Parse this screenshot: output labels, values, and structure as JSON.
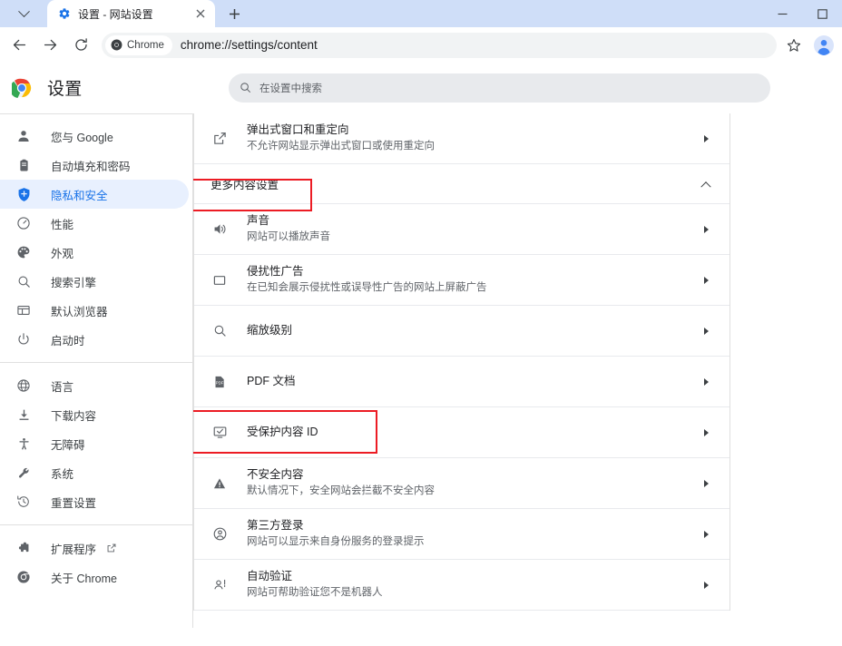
{
  "browser": {
    "tab": {
      "title": "设置 - 网站设置",
      "favicon_icon": "gear-blue-icon",
      "close_icon": "close-icon"
    },
    "tab_search_icon": "chevron-down-icon",
    "new_tab_label": "+",
    "window_controls": [
      {
        "name": "minimize",
        "glyph": "–"
      },
      {
        "name": "maximize",
        "glyph": "□"
      }
    ],
    "toolbar": {
      "back_icon": "back-arrow-icon",
      "forward_icon": "forward-arrow-icon",
      "reload_icon": "reload-icon",
      "chrome_chip_label": "Chrome",
      "url": "chrome://settings/content",
      "bookmark_icon": "star-icon",
      "profile_icon": "avatar-icon"
    }
  },
  "settings": {
    "logo_icon": "chrome-logo-icon",
    "title": "设置",
    "search": {
      "icon": "search-icon",
      "placeholder": "在设置中搜索",
      "value": ""
    }
  },
  "sidebar": {
    "groups": [
      {
        "items": [
          {
            "icon": "person-icon",
            "label": "您与 Google",
            "selected": false
          },
          {
            "icon": "clipboard-icon",
            "label": "自动填充和密码",
            "selected": false
          },
          {
            "icon": "shield-icon",
            "label": "隐私和安全",
            "selected": true
          },
          {
            "icon": "speedometer-icon",
            "label": "性能",
            "selected": false
          },
          {
            "icon": "palette-icon",
            "label": "外观",
            "selected": false
          },
          {
            "icon": "search-icon",
            "label": "搜索引擎",
            "selected": false
          },
          {
            "icon": "browser-window-icon",
            "label": "默认浏览器",
            "selected": false
          },
          {
            "icon": "power-icon",
            "label": "启动时",
            "selected": false
          }
        ]
      },
      {
        "items": [
          {
            "icon": "globe-icon",
            "label": "语言",
            "selected": false
          },
          {
            "icon": "download-icon",
            "label": "下载内容",
            "selected": false
          },
          {
            "icon": "accessibility-icon",
            "label": "无障碍",
            "selected": false
          },
          {
            "icon": "wrench-icon",
            "label": "系统",
            "selected": false
          },
          {
            "icon": "restore-icon",
            "label": "重置设置",
            "selected": false
          }
        ]
      },
      {
        "items": [
          {
            "icon": "puzzle-icon",
            "label": "扩展程序",
            "selected": false,
            "external_link_icon": "open-in-new-icon"
          },
          {
            "icon": "chrome-circle-icon",
            "label": "关于 Chrome",
            "selected": false
          }
        ]
      }
    ]
  },
  "main": {
    "rows": [
      {
        "type": "setting",
        "icon": "popup-redirect-icon",
        "title": "弹出式窗口和重定向",
        "subtitle": "不允许网站显示弹出式窗口或使用重定向",
        "arrow_icon": "chevron-right-icon"
      },
      {
        "type": "section",
        "title": "更多内容设置",
        "arrow_icon": "chevron-up-icon",
        "highlighted": true
      },
      {
        "type": "setting",
        "icon": "sound-icon",
        "title": "声音",
        "subtitle": "网站可以播放声音",
        "arrow_icon": "chevron-right-icon"
      },
      {
        "type": "setting",
        "icon": "intrusive-ads-icon",
        "title": "侵扰性广告",
        "subtitle": "在已知会展示侵扰性或误导性广告的网站上屏蔽广告",
        "arrow_icon": "chevron-right-icon"
      },
      {
        "type": "setting",
        "icon": "zoom-levels-icon",
        "title": "缩放级别",
        "subtitle": "",
        "arrow_icon": "chevron-right-icon"
      },
      {
        "type": "setting",
        "icon": "pdf-icon",
        "title": "PDF 文档",
        "subtitle": "",
        "arrow_icon": "chevron-right-icon"
      },
      {
        "type": "setting",
        "icon": "protected-content-icon",
        "title": "受保护内容 ID",
        "subtitle": "",
        "arrow_icon": "chevron-right-icon",
        "highlighted": true
      },
      {
        "type": "setting",
        "icon": "warning-icon",
        "title": "不安全内容",
        "subtitle": "默认情况下，安全网站会拦截不安全内容",
        "arrow_icon": "chevron-right-icon"
      },
      {
        "type": "setting",
        "icon": "federated-identity-icon",
        "title": "第三方登录",
        "subtitle": "网站可以显示来自身份服务的登录提示",
        "arrow_icon": "chevron-right-icon"
      },
      {
        "type": "setting",
        "icon": "auto-verify-icon",
        "title": "自动验证",
        "subtitle": "网站可帮助验证您不是机器人",
        "arrow_icon": "chevron-right-icon"
      }
    ]
  },
  "annotations": {
    "highlight_color": "#ec1c24",
    "boxes": [
      {
        "target": "更多内容设置",
        "note": "red-rectangle"
      },
      {
        "target": "受保护内容 ID",
        "note": "red-rectangle"
      }
    ]
  }
}
